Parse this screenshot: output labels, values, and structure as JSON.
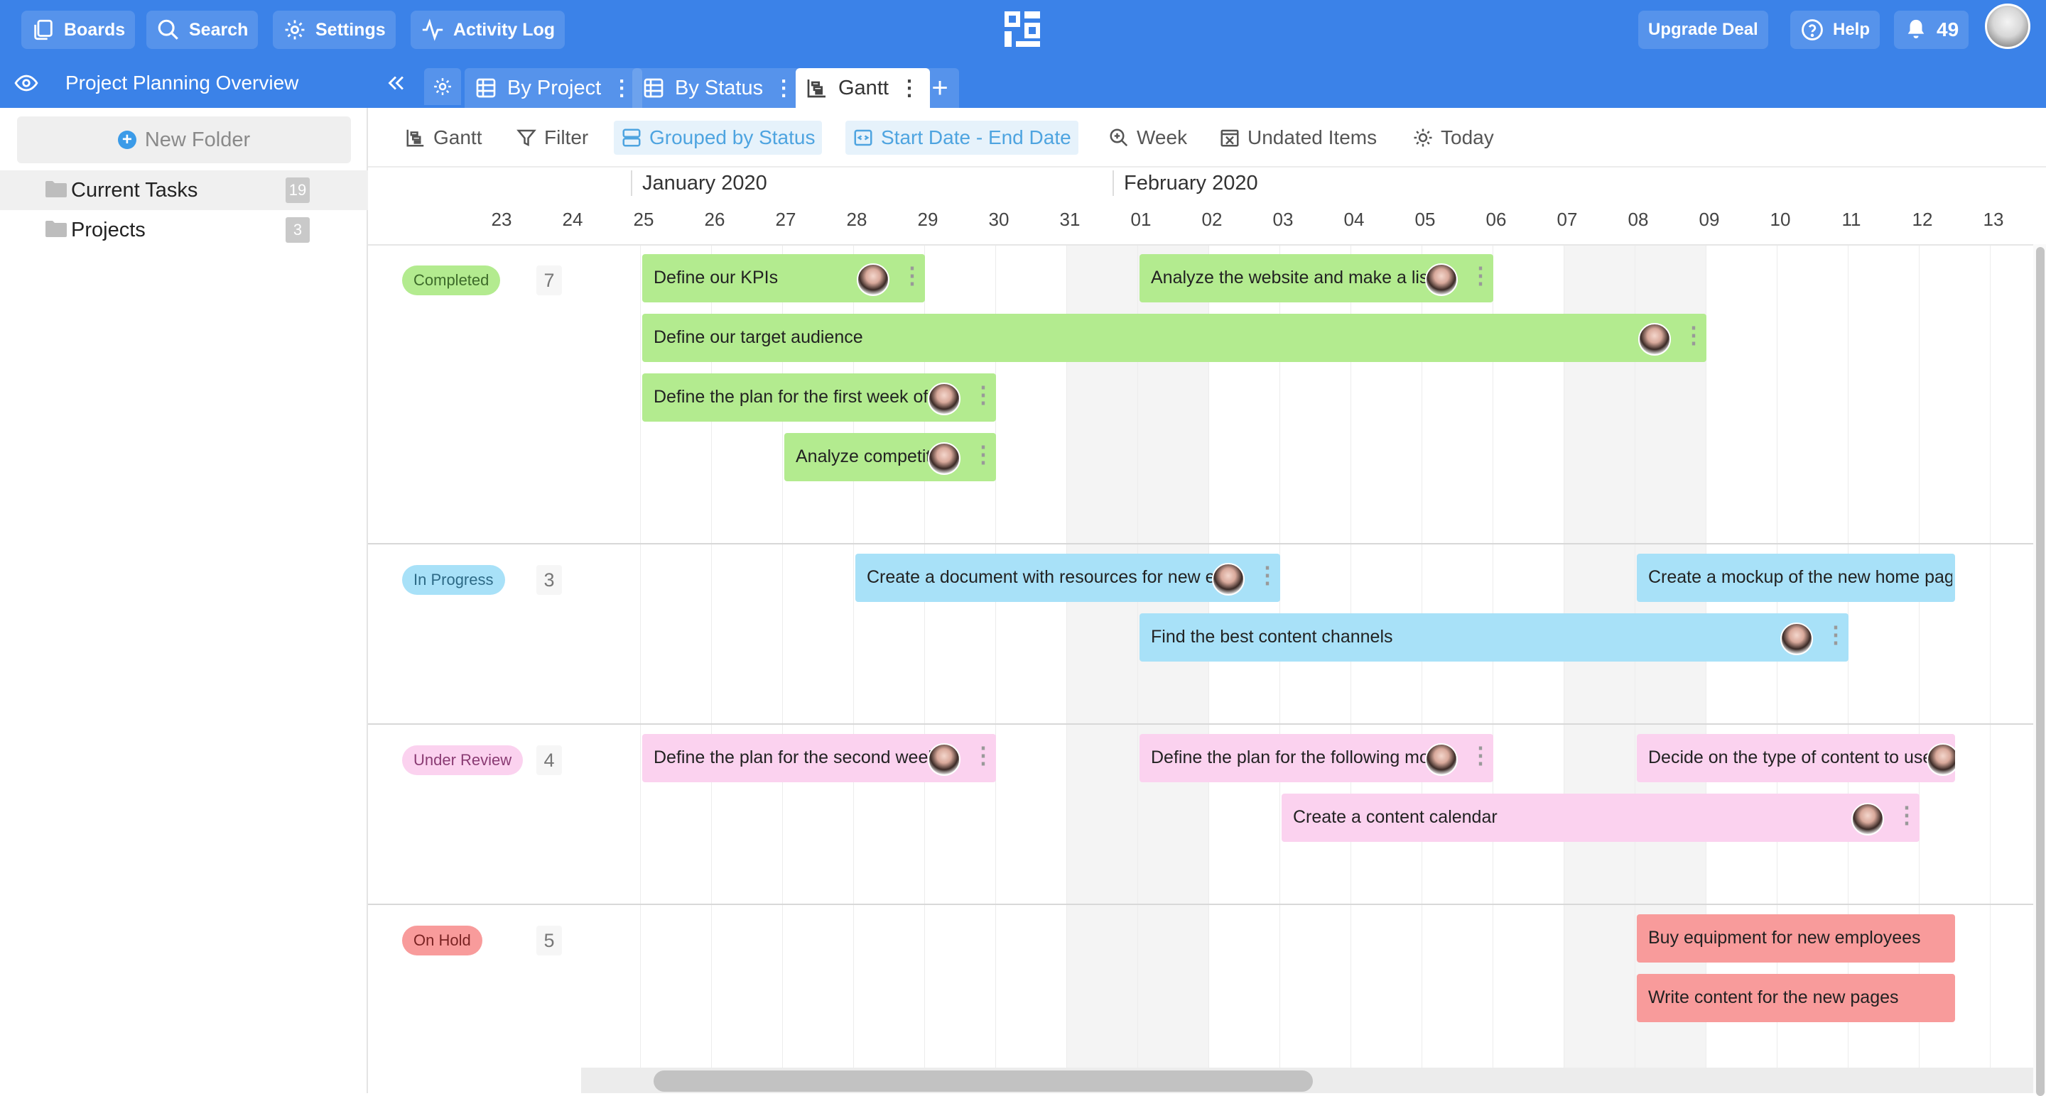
{
  "topbar": {
    "boards": "Boards",
    "search": "Search",
    "settings": "Settings",
    "activity_log": "Activity Log",
    "upgrade": "Upgrade Deal",
    "help": "Help",
    "notifications": "49"
  },
  "subbar": {
    "title": "Project Planning Overview",
    "tabs": [
      {
        "label": "By Project"
      },
      {
        "label": "By Status"
      },
      {
        "label": "Gantt"
      }
    ],
    "add": "+"
  },
  "sidebar": {
    "new_folder": "New Folder",
    "folders": [
      {
        "label": "Current Tasks",
        "count": "19"
      },
      {
        "label": "Projects",
        "count": "3"
      }
    ]
  },
  "toolbar": {
    "gantt": "Gantt",
    "filter": "Filter",
    "grouped": "Grouped by Status",
    "dates": "Start Date - End Date",
    "week": "Week",
    "undated": "Undated Items",
    "today": "Today"
  },
  "timeline": {
    "months": [
      "January 2020",
      "February 2020"
    ],
    "days": [
      "23",
      "24",
      "25",
      "26",
      "27",
      "28",
      "29",
      "30",
      "31",
      "01",
      "02",
      "03",
      "04",
      "05",
      "06",
      "07",
      "08",
      "09",
      "10",
      "11",
      "12",
      "13"
    ]
  },
  "groups": [
    {
      "status": "Completed",
      "count": "7",
      "pill_bg": "#b3eb8f",
      "pill_fg": "#3d6b2a",
      "bar_bg": "#b3eb8f",
      "tasks": [
        {
          "label": "Define our KPIs"
        },
        {
          "label": "Analyze the website and make a list of"
        },
        {
          "label": "Define our target audience"
        },
        {
          "label": "Define the plan for the first week of"
        },
        {
          "label": "Analyze competitors"
        }
      ]
    },
    {
      "status": "In Progress",
      "count": "3",
      "pill_bg": "#a8e1f8",
      "pill_fg": "#2d6a86",
      "bar_bg": "#a8e1f8",
      "tasks": [
        {
          "label": "Create a document with resources for new employees"
        },
        {
          "label": "Create a mockup of the new home page"
        },
        {
          "label": "Find the best content channels"
        }
      ]
    },
    {
      "status": "Under Review",
      "count": "4",
      "pill_bg": "#fbd2ef",
      "pill_fg": "#8a3b73",
      "bar_bg": "#fbd2ef",
      "tasks": [
        {
          "label": "Define the plan for the second week"
        },
        {
          "label": "Define the plan for the following month"
        },
        {
          "label": "Decide on the type of content to use"
        },
        {
          "label": "Create a content calendar"
        }
      ]
    },
    {
      "status": "On Hold",
      "count": "5",
      "pill_bg": "#f89b9b",
      "pill_fg": "#7a2323",
      "bar_bg": "#f89b9b",
      "tasks": [
        {
          "label": "Buy equipment for new employees"
        },
        {
          "label": "Write content for the new pages"
        }
      ]
    }
  ]
}
